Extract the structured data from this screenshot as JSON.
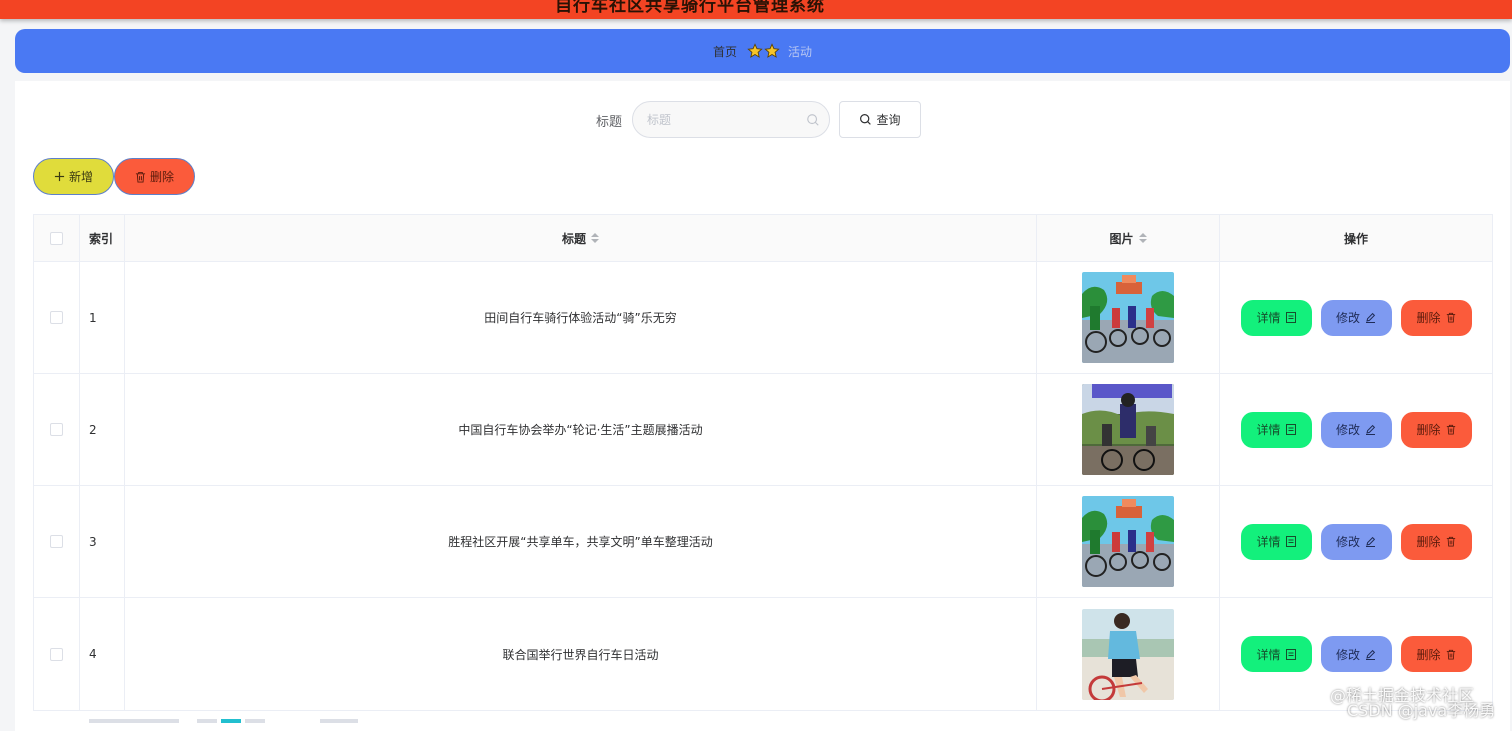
{
  "header": {
    "title": "自行车社区共享骑行平台管理系统"
  },
  "breadcrumb": {
    "home": "首页",
    "current": "活动"
  },
  "search": {
    "label": "标题",
    "placeholder": "标题",
    "query_label": "查询"
  },
  "toolbar": {
    "add_label": "新增",
    "delete_label": "删除"
  },
  "table": {
    "columns": {
      "index": "索引",
      "title": "标题",
      "image": "图片",
      "actions": "操作"
    },
    "rows": [
      {
        "index": "1",
        "title": "田间自行车骑行体验活动“骑”乐无穷",
        "image": "cyclists-group-photo"
      },
      {
        "index": "2",
        "title": "中国自行车协会举办“轮记·生活”主题展播活动",
        "image": "cyclists-event-photo"
      },
      {
        "index": "3",
        "title": "胜程社区开展“共享单车，共享文明”单车整理活动",
        "image": "cyclists-group-photo"
      },
      {
        "index": "4",
        "title": "联合国举行世界自行车日活动",
        "image": "cyclist-woman-photo"
      }
    ],
    "actions": {
      "detail": "详情",
      "edit": "修改",
      "delete": "删除"
    }
  },
  "watermark": {
    "line1": "@稀土掘金技术社区",
    "line2": "CSDN @java李杨勇"
  },
  "colors": {
    "topbar": "#f34423",
    "breadcrumb": "#4a79f3",
    "add_button": "#e0dc3b",
    "delete_button": "#fb5b3b",
    "detail_button": "#13f07c",
    "edit_button": "#7e9af1"
  }
}
